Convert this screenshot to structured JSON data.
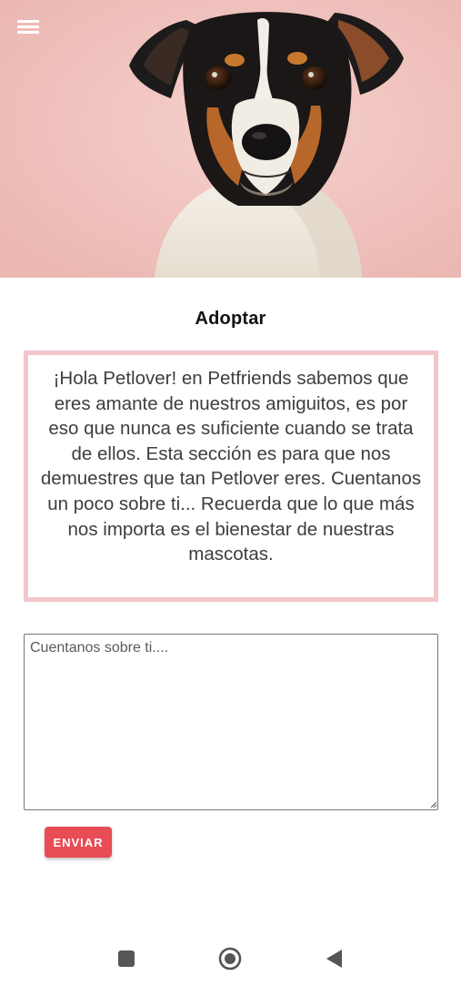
{
  "header": {
    "menu_icon": "hamburger-menu-icon",
    "hero_image": "dog-portrait"
  },
  "main": {
    "title": "Adoptar",
    "intro_text": "¡Hola Petlover! en Petfriends sabemos que eres amante de nuestros amiguitos, es por eso que nunca es suficiente cuando se trata de ellos. Esta sección es para que nos demuestres que tan Petlover eres. Cuentanos un poco sobre ti... Recuerda que lo que más nos importa es el bienestar de nuestras mascotas.",
    "story_input": {
      "placeholder": "Cuentanos sobre ti....",
      "value": ""
    },
    "send_label": "ENVIAR"
  },
  "nav": {
    "recents_icon": "square-recents-icon",
    "home_icon": "circle-home-icon",
    "back_icon": "triangle-back-icon"
  },
  "colors": {
    "hero_bg": "#f2c6c2",
    "box_border": "#f2c6cc",
    "button_bg": "#e84c55",
    "button_text": "#ffffff"
  }
}
